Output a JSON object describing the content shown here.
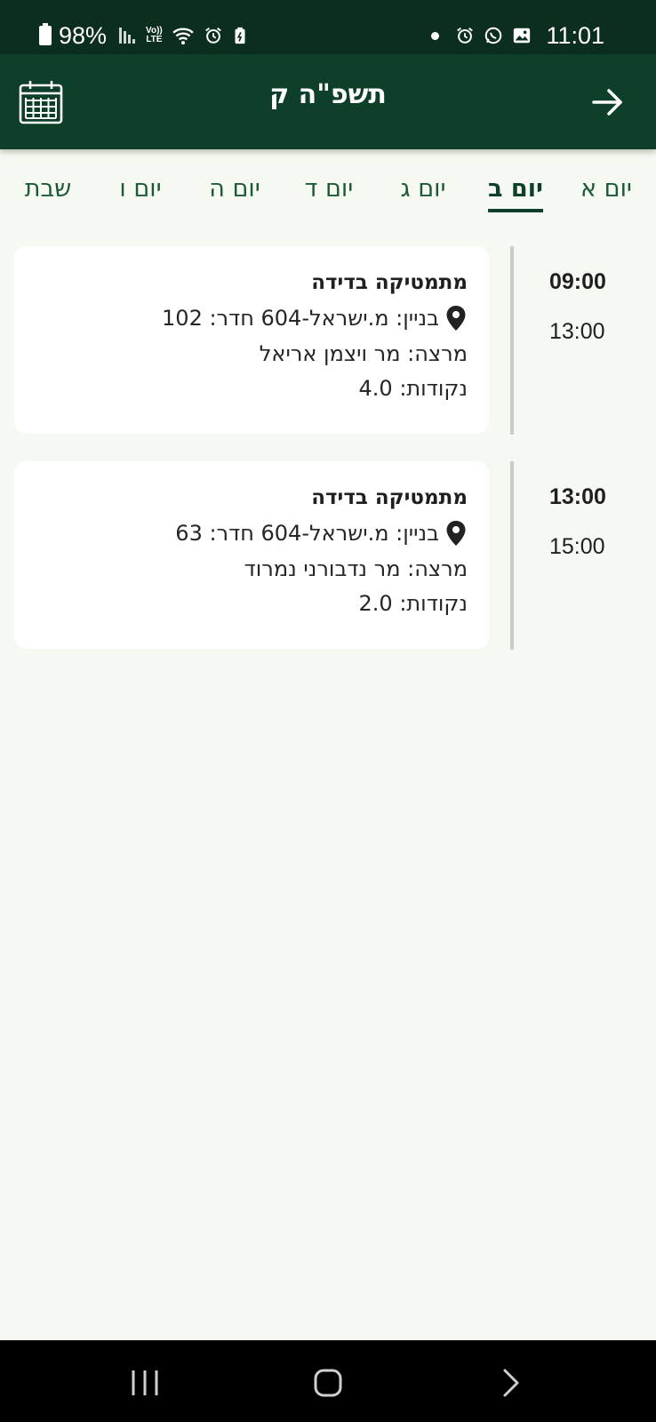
{
  "status_bar": {
    "battery": "98%",
    "volte_top": "Vo))",
    "volte_bottom": "LTE",
    "time": "11:01"
  },
  "app_bar": {
    "title": "תשפ\"ה ק",
    "calendar_icon": "calendar-icon",
    "back_icon": "arrow-right-icon"
  },
  "tabs": [
    {
      "label": "יום א",
      "active": false
    },
    {
      "label": "יום ב",
      "active": true
    },
    {
      "label": "יום ג",
      "active": false
    },
    {
      "label": "יום ד",
      "active": false
    },
    {
      "label": "יום ה",
      "active": false
    },
    {
      "label": "יום ו",
      "active": false
    },
    {
      "label": "שבת",
      "active": false
    }
  ],
  "schedule": [
    {
      "start": "09:00",
      "end": "13:00",
      "course": "מתמטיקה בדידה",
      "location": "בניין: מ.ישראל-604 חדר: 102",
      "lecturer": "מרצה: מר ויצמן אריאל",
      "credits": "נקודות: 4.0"
    },
    {
      "start": "13:00",
      "end": "15:00",
      "course": "מתמטיקה בדידה",
      "location": "בניין: מ.ישראל-604 חדר: 63",
      "lecturer": "מרצה: מר נדבורני נמרוד",
      "credits": "נקודות: 2.0"
    }
  ],
  "colors": {
    "status_bar": "#0c2e1e",
    "app_bar": "#0e4029",
    "background": "#f6f9f1",
    "card": "#ffffff"
  }
}
